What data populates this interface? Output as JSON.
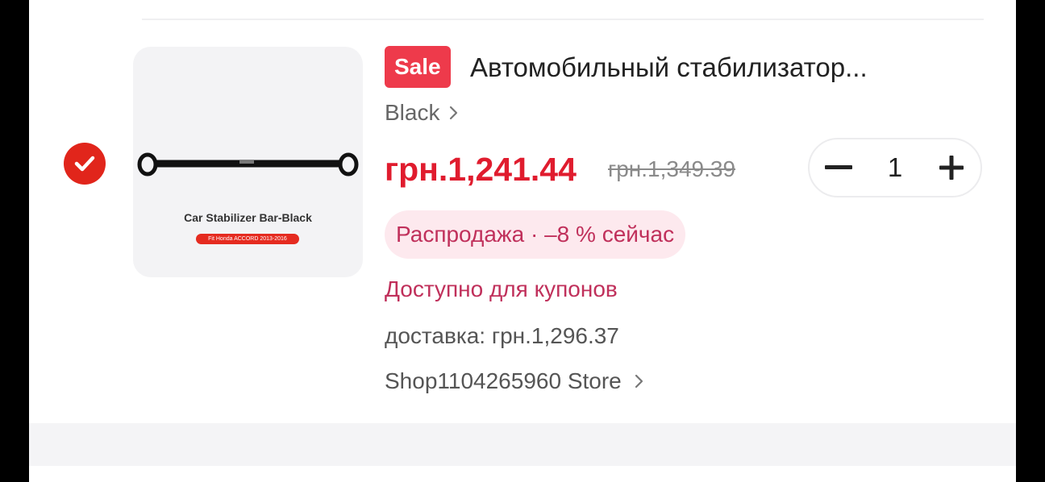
{
  "item": {
    "selected": true,
    "sale_badge": "Sale",
    "title": "Автомобильный стабилизатор...",
    "variant": "Black",
    "price": "грн.1,241.44",
    "old_price": "грн.1,349.39",
    "quantity": "1",
    "promo": "Распродажа · –8 % сейчас",
    "coupons": "Доступно для купонов",
    "shipping": "доставка: грн.1,296.37",
    "store": "Shop1104265960 Store",
    "thumbnail": {
      "caption": "Car Stabilizer Bar-Black",
      "tag": "Fit Honda ACCORD 2013-2016"
    }
  },
  "colors": {
    "accent": "#e01c2e",
    "badge": "#ee3a4b",
    "promo_bg": "#fde9ee",
    "promo_text": "#c0305b"
  },
  "icons": {
    "checkbox": "check-circle-icon",
    "variant_chevron": "chevron-right-icon",
    "store_chevron": "chevron-right-icon",
    "decrement": "minus-icon",
    "increment": "plus-icon"
  }
}
